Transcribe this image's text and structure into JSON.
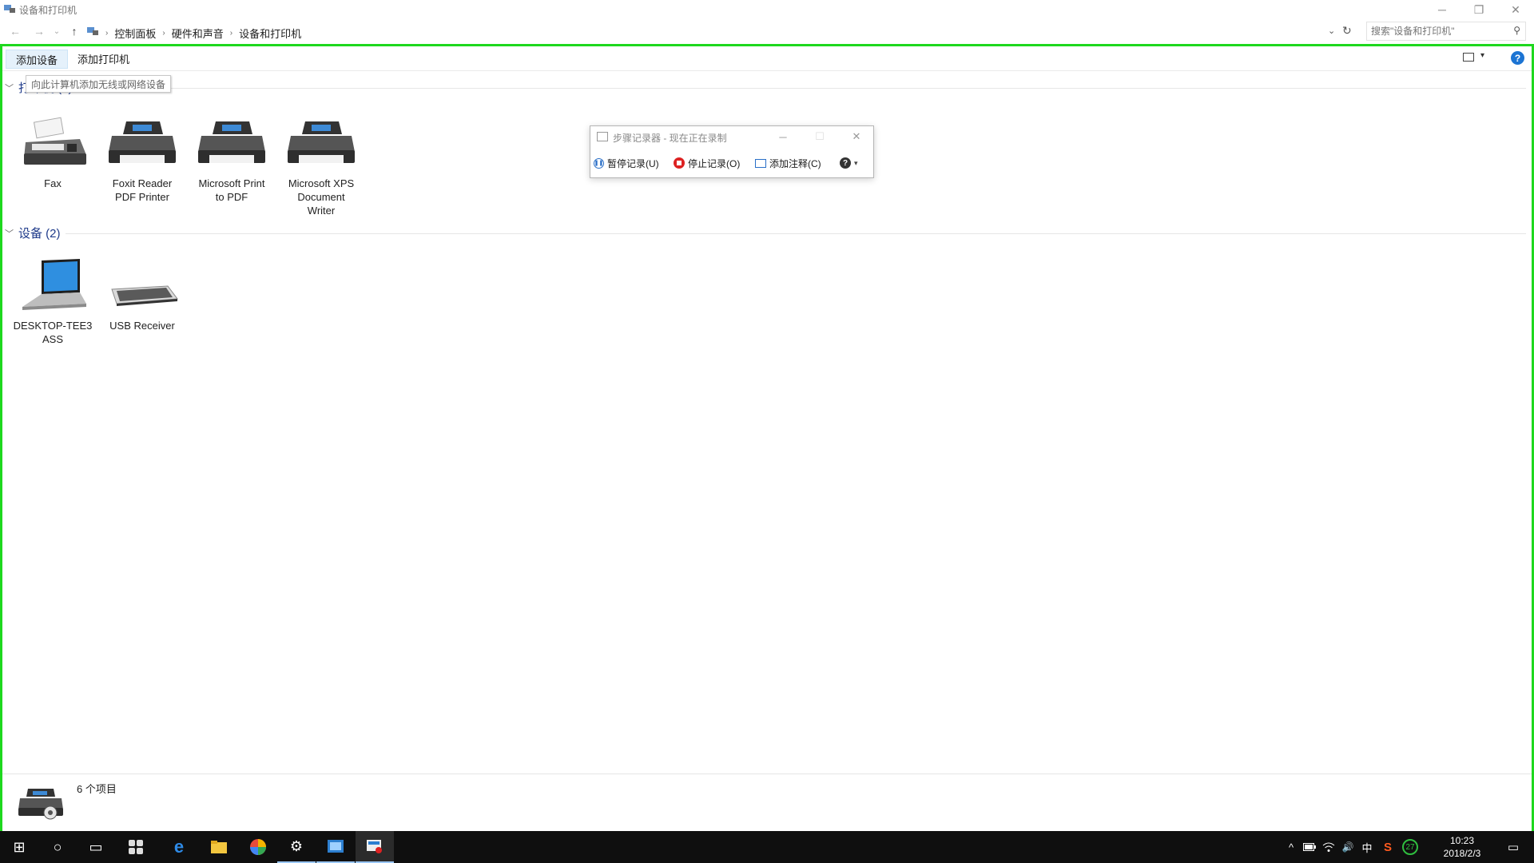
{
  "window": {
    "title": "设备和打印机",
    "minimize_label": "─",
    "restore_label": "❐",
    "close_label": "✕"
  },
  "address_bar": {
    "back_glyph": "←",
    "forward_glyph": "→",
    "recent_glyph": "⌄",
    "up_glyph": "↑",
    "breadcrumb": [
      "控制面板",
      "硬件和声音",
      "设备和打印机"
    ],
    "separator": "›",
    "dropdown_glyph": "⌄",
    "refresh_glyph": "↻",
    "search_placeholder": "搜索\"设备和打印机\"",
    "search_glyph": "⚲"
  },
  "command_bar": {
    "add_device": "添加设备",
    "add_printer": "添加打印机",
    "view_dropdown_glyph": "▾",
    "help_glyph": "?"
  },
  "tooltip": {
    "text": "向此计算机添加无线或网络设备"
  },
  "groups": {
    "printers": {
      "header": "打印机 (4)",
      "items": [
        {
          "label_lines": [
            "Fax"
          ],
          "icon": "fax-icon"
        },
        {
          "label_lines": [
            "Foxit Reader",
            "PDF Printer"
          ],
          "icon": "printer-icon"
        },
        {
          "label_lines": [
            "Microsoft Print",
            "to PDF"
          ],
          "icon": "printer-icon"
        },
        {
          "label_lines": [
            "Microsoft XPS",
            "Document",
            "Writer"
          ],
          "icon": "printer-icon"
        }
      ]
    },
    "devices": {
      "header": "设备 (2)",
      "items": [
        {
          "label_lines": [
            "DESKTOP-TEE3",
            "ASS"
          ],
          "icon": "laptop-icon"
        },
        {
          "label_lines": [
            "USB Receiver"
          ],
          "icon": "keyboard-icon"
        }
      ]
    }
  },
  "steps_recorder": {
    "title": "步骤记录器 - 现在正在录制",
    "pause": "暂停记录(U)",
    "stop": "停止记录(O)",
    "add_comment": "添加注释(C)",
    "help_glyph": "?",
    "dropdown_glyph": "▾",
    "minimize_label": "─",
    "maximize_label": "☐",
    "close_label": "✕"
  },
  "status_bar": {
    "count": "6 个项目"
  },
  "taskbar": {
    "start_glyph": "⊞",
    "search_glyph": "○",
    "task_view_glyph": "▭",
    "settings_glyph": "⚙",
    "tray_up_glyph": "^",
    "volume_glyph": "🔊",
    "ime": "中",
    "badge": "27",
    "time": "10:23",
    "date": "2018/2/3",
    "notification_glyph": "▭"
  },
  "colors": {
    "frame": "#1ed81e",
    "accent": "#1c74d3",
    "group_header": "#1e3a8a",
    "taskbar": "#0f0f0f"
  }
}
